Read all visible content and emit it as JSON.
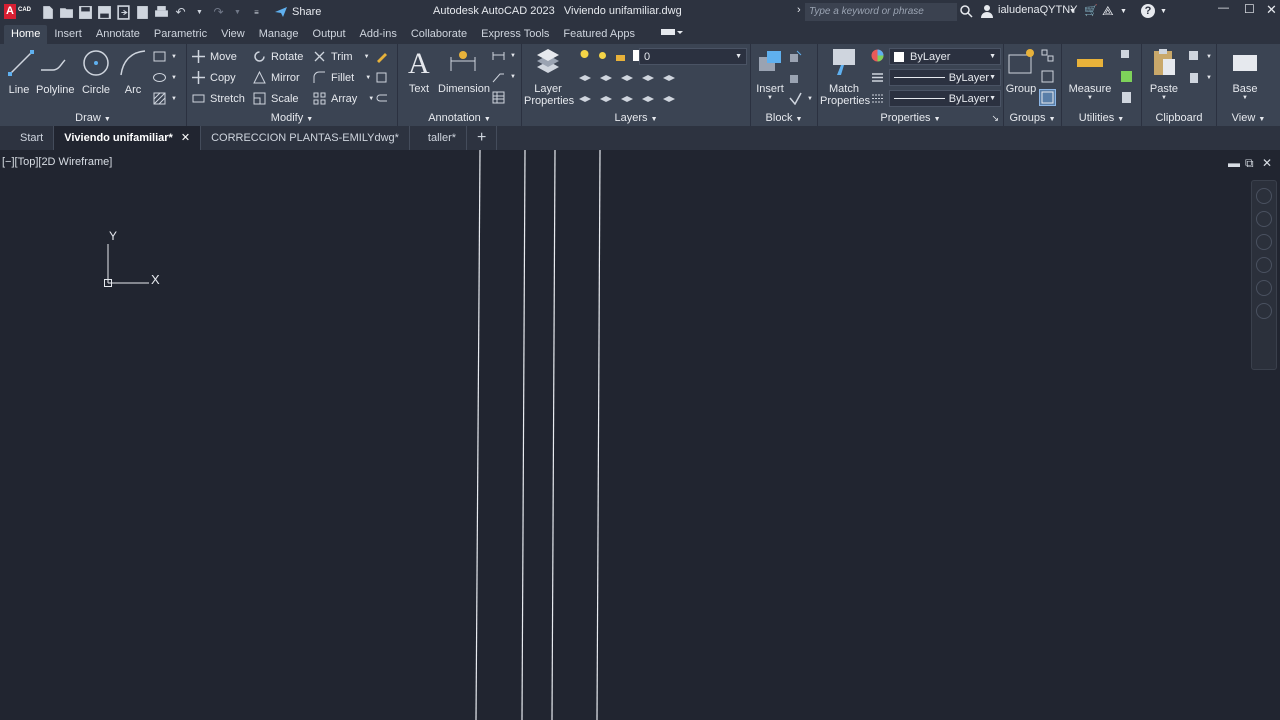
{
  "app": {
    "title": "Autodesk AutoCAD 2023",
    "file": "Viviendo unifamiliar.dwg",
    "logo": "A",
    "logo_sub": "CAD"
  },
  "qat": {
    "share": "Share",
    "icons": [
      "new-icon",
      "open-icon",
      "save-icon",
      "saveas-icon",
      "web-open-icon",
      "web-save-icon",
      "print-icon",
      "undo-icon",
      "redo-icon"
    ]
  },
  "search": {
    "placeholder": "Type a keyword or phrase"
  },
  "user": {
    "name": "ialudenaQYTNY"
  },
  "ribbon_tabs": [
    "Home",
    "Insert",
    "Annotate",
    "Parametric",
    "View",
    "Manage",
    "Output",
    "Add-ins",
    "Collaborate",
    "Express Tools",
    "Featured Apps"
  ],
  "draw": {
    "title": "Draw",
    "line": "Line",
    "polyline": "Polyline",
    "circle": "Circle",
    "arc": "Arc"
  },
  "modify": {
    "title": "Modify",
    "move": "Move",
    "rotate": "Rotate",
    "trim": "Trim",
    "copy": "Copy",
    "mirror": "Mirror",
    "fillet": "Fillet",
    "stretch": "Stretch",
    "scale": "Scale",
    "array": "Array"
  },
  "annotation": {
    "title": "Annotation",
    "text": "Text",
    "dimension": "Dimension"
  },
  "layers": {
    "title": "Layers",
    "layer_properties_1": "Layer",
    "layer_properties_2": "Properties",
    "current": "0"
  },
  "block": {
    "title": "Block",
    "insert": "Insert"
  },
  "properties": {
    "title": "Properties",
    "match_1": "Match",
    "match_2": "Properties",
    "color": "ByLayer",
    "linetype": "ByLayer",
    "lineweight": "ByLayer"
  },
  "groups": {
    "title": "Groups",
    "group": "Group"
  },
  "utilities": {
    "title": "Utilities",
    "measure": "Measure"
  },
  "clipboard": {
    "title": "Clipboard",
    "paste": "Paste"
  },
  "view": {
    "title": "View",
    "base": "Base"
  },
  "doctabs": [
    "Start",
    "Viviendo unifamiliar*",
    "CORRECCION PLANTAS-EMILYdwg*",
    "taller*"
  ],
  "viewport": {
    "label": "[−][Top][2D Wireframe]",
    "ucs_x": "X",
    "ucs_y": "Y"
  }
}
